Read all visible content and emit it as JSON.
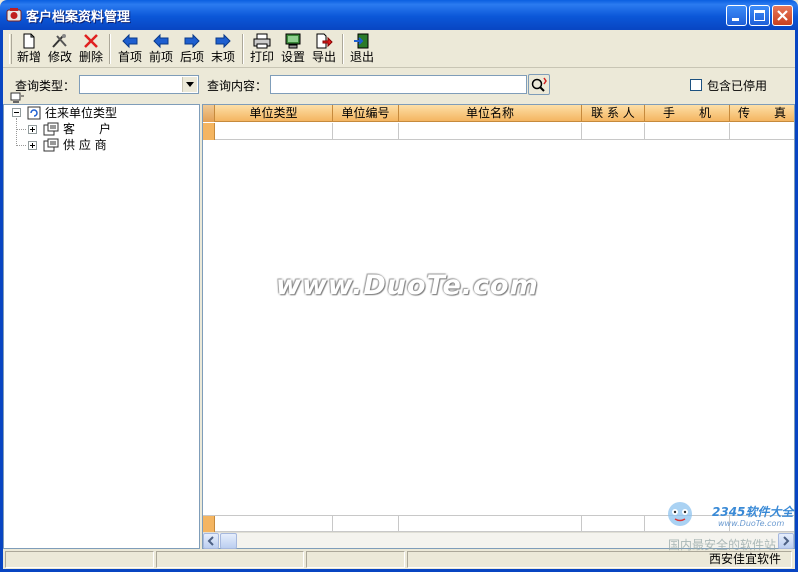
{
  "window": {
    "title": "客户档案资料管理"
  },
  "toolbar": {
    "new_label": "新增",
    "edit_label": "修改",
    "delete_label": "删除",
    "first_label": "首项",
    "prev_label": "前项",
    "next_label": "后项",
    "last_label": "末项",
    "print_label": "打印",
    "settings_label": "设置",
    "export_label": "导出",
    "exit_label": "退出"
  },
  "query": {
    "type_label": "查询类型：",
    "type_value": "",
    "content_label": "查询内容：",
    "content_value": "",
    "include_disabled_label": "包含已停用",
    "include_disabled_checked": false
  },
  "tree": {
    "root_label": "往来单位类型",
    "children": [
      {
        "label": "客　　户"
      },
      {
        "label": "供 应 商"
      }
    ]
  },
  "grid": {
    "columns": [
      "单位类型",
      "单位编号",
      "单位名称",
      "联 系 人",
      "手　　机",
      "传　　真"
    ],
    "rows": []
  },
  "watermark": {
    "text": "www.DuoTe.com",
    "brand": "2345软件大全",
    "url": "www.DuoTe.com",
    "slogan": "国内最安全的软件站"
  },
  "statusbar": {
    "company": "西安佳宜软件"
  }
}
